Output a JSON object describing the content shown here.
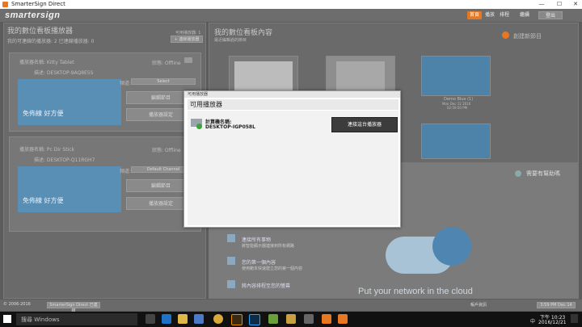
{
  "window": {
    "title": "SmarterSign Direct",
    "minimize": "—",
    "maximize": "☐",
    "close": "✕"
  },
  "app": {
    "logo": "smartersign",
    "nav": [
      "首頁",
      "播放",
      "排程",
      "繼續",
      "登出"
    ]
  },
  "left_panel": {
    "title": "我的數位看板播放器",
    "subtitle": "我的可連線的播放器: 2 已連線播放器: 0",
    "count_label": "可用播放器: 1",
    "add_button": "+ 連線播放器",
    "players": [
      {
        "name_label": "播放器名稱: Kitty Tablet",
        "desc_label": "描述: DESKTOP-9AQ8E5S",
        "status": "狀態: Offline",
        "channel_label": "頻道:",
        "channel_value": "Select",
        "slide_text": "免佈線 好方便",
        "edit_button": "編輯節目",
        "settings_button": "播放器設定"
      },
      {
        "name_label": "播放器名稱: Pc Dir Stick",
        "desc_label": "描述: DESKTOP-Q11RGH7",
        "status": "狀態: Offline",
        "channel_label": "頻道:",
        "channel_value": "Default Channel",
        "slide_text": "免佈線 好方便",
        "edit_button": "編輯節目",
        "settings_button": "播放器設定"
      }
    ]
  },
  "right_panel": {
    "title": "我的數位看板內容",
    "subtitle": "最近編輯過的節目",
    "new_button": "創建新節目",
    "thumbs": [
      {
        "label": ""
      },
      {
        "label": ""
      },
      {
        "label": "Demo Blue (1)",
        "date": "Mon Dec 12 2016",
        "time": "02:59:50 PM"
      }
    ],
    "help_link": "需要有幫助嗎",
    "getting_started": [
      {
        "title": "連接所有事物",
        "text": "將智能顯示器連接到所有網路"
      },
      {
        "title": "您的第一個內容",
        "text": "使用範本快速建立您的第一個內容"
      },
      {
        "title": "將內容排程至您的螢幕",
        "text": ""
      }
    ],
    "cloud_text": "Put your network in the cloud"
  },
  "dialog": {
    "title": "可用播放器",
    "header": "可用播放器",
    "computer_name_label": "計算機名稱:",
    "computer_name": "DESKTOP-IGP058L",
    "connect_button": "連接這台播放器"
  },
  "statusbar": {
    "copyright": "© 2006-2016",
    "center": "SmarterSign Direct 已連線",
    "account": "帳戶資訊",
    "time": "3:59 PM Dec 14"
  },
  "taskbar": {
    "search_placeholder": "搜尋 Windows",
    "time": "下午 10:23",
    "date": "2016/12/21",
    "ime": "中",
    "icons": [
      "task-view-icon",
      "edge-icon",
      "file-explorer-icon",
      "store-icon",
      "chrome-icon",
      "illustrator-icon",
      "photoshop-icon",
      "dropbox-icon",
      "folder-icon",
      "photo-icon",
      "smartersign-icon",
      "smartersign-icon"
    ]
  }
}
